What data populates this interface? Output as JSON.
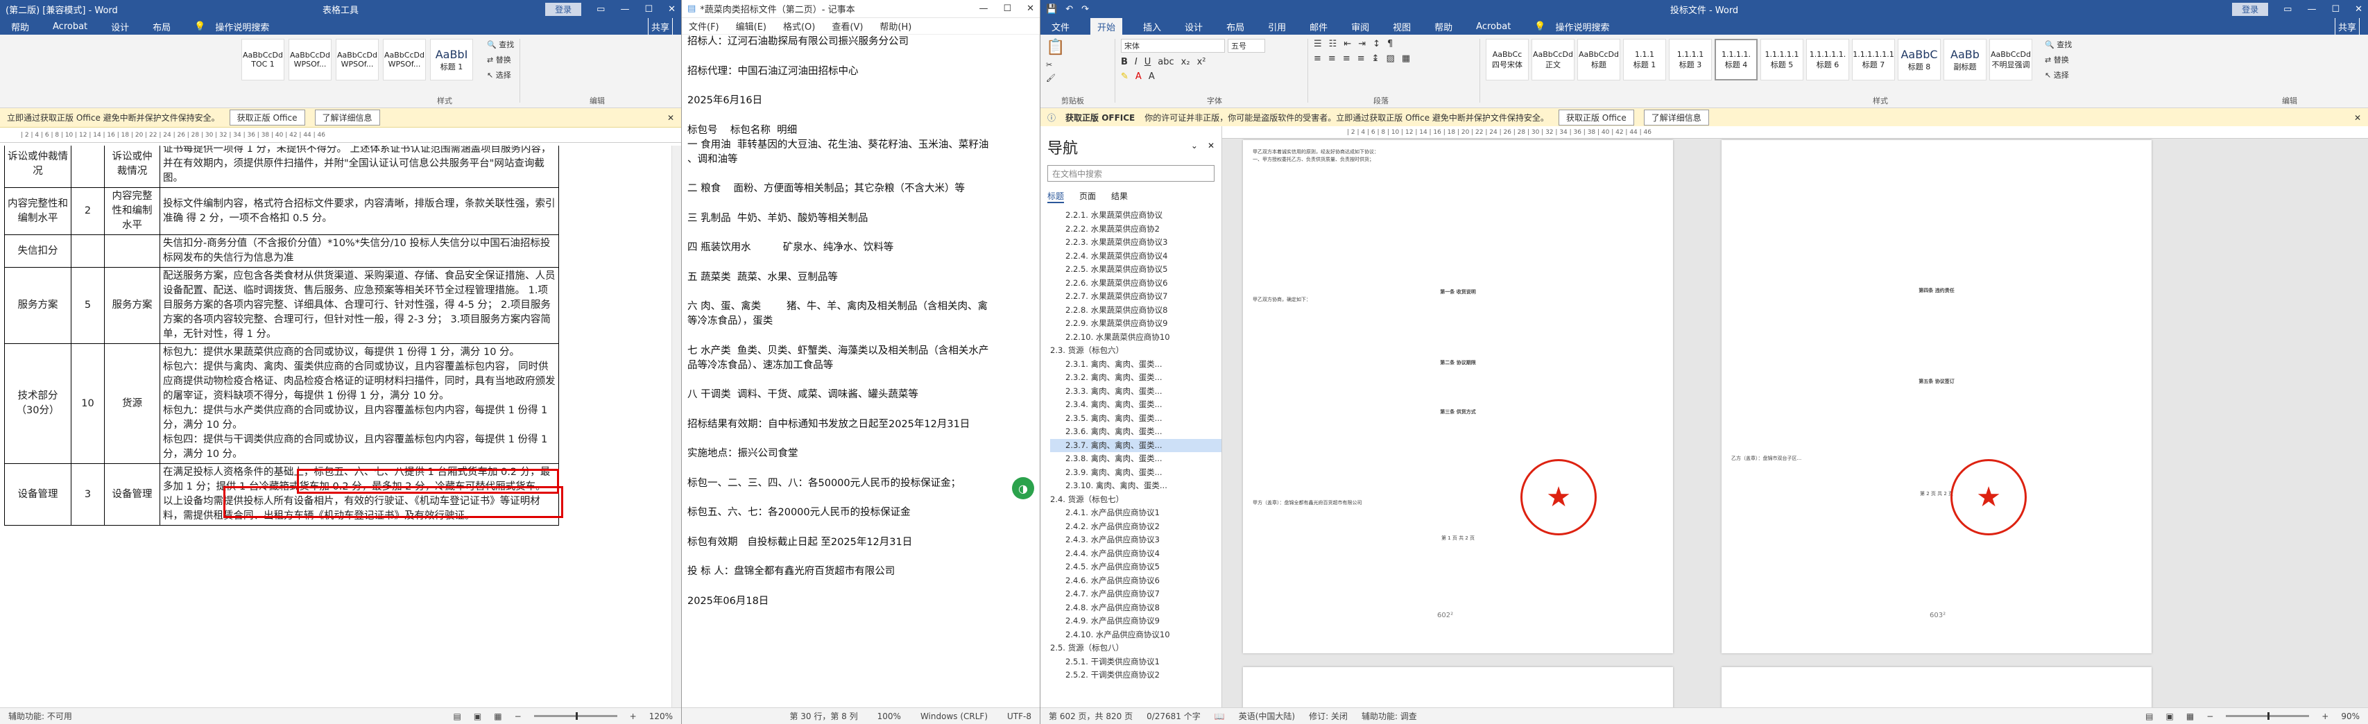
{
  "win1": {
    "title": "(第二版) [兼容模式] - Word",
    "table_tools": "表格工具",
    "login": "登录",
    "tabs": [
      "帮助",
      "Acrobat",
      "设计",
      "布局"
    ],
    "tellme": "操作说明搜索",
    "share": "共享",
    "styles": [
      {
        "preview": "AaBbCcDd",
        "name": "TOC 1"
      },
      {
        "preview": "AaBbCcDd",
        "name": "WPSOf..."
      },
      {
        "preview": "AaBbCcDd",
        "name": "WPSOf..."
      },
      {
        "preview": "AaBbCcDd",
        "name": "WPSOf..."
      },
      {
        "preview": "AaBbI",
        "name": "标题 1"
      }
    ],
    "edit_group": {
      "find": "查找",
      "replace": "替换",
      "select": "选择",
      "label": "编辑"
    },
    "styles_label": "样式",
    "msg": {
      "text": "立即通过获取正版 Office 避免中断并保护文件保持安全。",
      "btn1": "获取正版 Office",
      "btn2": "了解详细信息"
    },
    "table": {
      "rows": [
        {
          "c1": "诉讼或仲裁情况",
          "c2": "",
          "c3": "诉讼或仲裁情况",
          "c4": "证书每提供一项得 1 分，未提供不得分。 上述体系证书认证范围需涵盖项目服务内容，并在有效期内，须提供原件扫描件，并附\"全国认证认可信息公共服务平台\"网站查询截图。"
        },
        {
          "c1": "内容完整性和编制水平",
          "c2": "2",
          "c3": "内容完整性和编制水平",
          "c4": "投标文件编制内容，格式符合招标文件要求，内容清晰，排版合理，条款关联性强，索引准确 得 2 分，一项不合格扣 0.5 分。"
        },
        {
          "c1": "失信扣分",
          "c2": "",
          "c3": "",
          "c4": "失信扣分-商务分值（不含报价分值）*10%*失信分/10 投标人失信分以中国石油招标投标网发布的失信行为信息为准"
        },
        {
          "c1": "服务方案",
          "c2": "5",
          "c3": "服务方案",
          "c4": "配送服务方案，应包含各类食材从供货渠道、采购渠道、存储、食品安全保证措施、人员设备配置、配送、临时调拨货、售后服务、应急预案等相关环节全过程管理措施。 1.项目服务方案的各项内容完整、详细具体、合理可行、针对性强，得 4-5 分； 2.项目服务方案的各项内容较完整、合理可行，但针对性一般，得 2-3 分； 3.项目服务方案内容简单，无针对性，得 1 分。"
        },
        {
          "c1": "技术部分（30分）",
          "c2": "10",
          "c3": "货源",
          "c4a": "标包九：提供水果蔬菜供应商的合同或协议，每提供 1 份得 1 分，满分 10 分。",
          "c4b": "标包六：提供与禽肉、禽肉、蛋类供应商的合同或协议，且内容覆盖标包内容， 同时供应商提供动物检疫合格证、肉品检疫合格证的证明材料扫描件，同时，具有当地政府颁发的屠宰证，资料缺项不得分，每提供 1 份得 1 分，满分 10 分。",
          "c4c": "标包九：提供与水产类供应商的合同或协议，且内容覆盖标包内内容，每提供 1 份得 1 分，满分 10 分。",
          "c4d": "标包四：提供与干调类供应商的合同或协议，且内容覆盖标包内内容，每提供 1 份得 1 分，满分 10 分。"
        },
        {
          "c1": "设备管理",
          "c2": "3",
          "c3": "设备管理",
          "c4": "在满足投标人资格条件的基础上，标包五、六、七、八提供 1 台厢式货车加 0.2 分，最多加 1 分；提供 1 台冷藏箱式货车加 0.2 分，最多加 2 分，冷藏车可替代厢式货车。 以上设备均需提供投标人所有设备相片，有效的行驶证、《机动车登记证书》等证明材料，需提供租赁合同、出租方车辆《机动车登记证书》及有效行驶证。"
        }
      ]
    },
    "status": {
      "accessibility": "辅助功能: 不可用",
      "zoom": "120%"
    }
  },
  "win2": {
    "title": "*蔬菜肉类招标文件（第二页）- 记事本",
    "menu": [
      "文件(F)",
      "编辑(E)",
      "格式(O)",
      "查看(V)",
      "帮助(H)"
    ],
    "lines": [
      "招标人：辽河石油勘探局有限公司振兴服务分公司",
      "招标代理：中国石油辽河油田招标中心",
      "2025年6月16日",
      "标包号    标包名称  明细\n一 食用油  菲转基因的大豆油、花生油、葵花籽油、玉米油、菜籽油\n、调和油等",
      "二 粮食    面粉、方便面等相关制品；其它杂粮（不含大米）等",
      "三 乳制品  牛奶、羊奶、酸奶等相关制品",
      "四 瓶装饮用水          矿泉水、纯净水、饮料等",
      "五 蔬菜类  蔬菜、水果、豆制品等",
      "六 肉、蛋、禽类        猪、牛、羊、禽肉及相关制品（含相关肉、禽\n等冷冻食品），蛋类",
      "七 水产类  鱼类、贝类、虾蟹类、海藻类以及相关制品（含相关水产\n品等冷冻食品）、速冻加工食品等",
      "八 干调类  调料、干货、咸菜、调味酱、罐头蔬菜等",
      "招标结果有效期：自中标通知书发放之日起至2025年12月31日",
      "实施地点：振兴公司食堂",
      "标包一、二、三、四、八：各50000元人民币的投标保证金；",
      "标包五、六、七：各20000元人民币的投标保证金",
      "标包有效期   自投标截止日起 至2025年12月31日",
      "投 标 人：盘锦全都有鑫光府百货超市有限公司",
      "2025年06月18日"
    ],
    "status": {
      "pos": "第 30 行，第 8 列",
      "zoom": "100%",
      "eol": "Windows (CRLF)",
      "enc": "UTF-8"
    }
  },
  "win3": {
    "title": "投标文件 - Word",
    "login": "登录",
    "tabs": [
      "文件",
      "开始",
      "插入",
      "设计",
      "布局",
      "引用",
      "邮件",
      "审阅",
      "视图",
      "帮助",
      "Acrobat"
    ],
    "tellme": "操作说明搜索",
    "share": "共享",
    "font_name": "宋体",
    "font_size": "五号",
    "styles": [
      {
        "preview": "AaBbCc",
        "name": "四号宋体"
      },
      {
        "preview": "AaBbCcDd",
        "name": "正文"
      },
      {
        "preview": "AaBbCcDd",
        "name": "标题"
      },
      {
        "preview": "1.1.1",
        "name": "标题 1"
      },
      {
        "preview": "1.1.1.1",
        "name": "标题 3"
      },
      {
        "preview": "1.1.1.1.",
        "name": "标题 4"
      },
      {
        "preview": "1.1.1.1.1",
        "name": "标题 5"
      },
      {
        "preview": "1.1.1.1.1.",
        "name": "标题 6"
      },
      {
        "preview": "1.1.1.1.1.1",
        "name": "标题 7"
      },
      {
        "preview": "AaBbC",
        "name": "标题 8"
      },
      {
        "preview": "AaBb",
        "name": "副标题"
      },
      {
        "preview": "AaBbCcDd",
        "name": "不明显强调"
      }
    ],
    "groups": {
      "clipboard": "剪贴板",
      "font": "字体",
      "paragraph": "段落",
      "styles": "样式",
      "edit": "编辑"
    },
    "edit_group": {
      "find": "查找",
      "replace": "替换",
      "select": "选择"
    },
    "msg": {
      "title": "获取正版 OFFICE",
      "text": "你的许可证并非正版，你可能是盗版软件的受害者。立即通过获取正版 Office 避免中断并保护文件保持安全。",
      "btn1": "获取正版 Office",
      "btn2": "了解详细信息"
    },
    "nav": {
      "title": "导航",
      "search": "在文档中搜索",
      "tabs": [
        "标题",
        "页面",
        "结果"
      ],
      "items": [
        "2.2.1. 水果蔬菜供应商协议",
        "2.2.2. 水果蔬菜供应商协2",
        "2.2.3. 水果蔬菜供应商协议3",
        "2.2.4. 水果蔬菜供应商协议4",
        "2.2.5. 水果蔬菜供应商协议5",
        "2.2.6. 水果蔬菜供应商协议6",
        "2.2.7. 水果蔬菜供应商协议7",
        "2.2.8. 水果蔬菜供应商协议8",
        "2.2.9. 水果蔬菜供应商协议9",
        "2.2.10. 水果蔬菜供应商协10",
        "2.3. 货源（标包六）",
        "2.3.1. 禽肉、禽肉、蛋类...",
        "2.3.2. 禽肉、禽肉、蛋类...",
        "2.3.3. 禽肉、禽肉、蛋类...",
        "2.3.4. 禽肉、禽肉、蛋类...",
        "2.3.5. 禽肉、禽肉、蛋类...",
        "2.3.6. 禽肉、禽肉、蛋类...",
        "2.3.7. 禽肉、禽肉、蛋类...",
        "2.3.8. 禽肉、禽肉、蛋类...",
        "2.3.9. 禽肉、禽肉、蛋类...",
        "2.3.10. 禽肉、禽肉、蛋类...",
        "2.4. 货源（标包七）",
        "2.4.1. 水产品供应商协议1",
        "2.4.2. 水产品供应商协议2",
        "2.4.3. 水产品供应商协议3",
        "2.4.4. 水产品供应商协议4",
        "2.4.5. 水产品供应商协议5",
        "2.4.6. 水产品供应商协议6",
        "2.4.7. 水产品供应商协议7",
        "2.4.8. 水产品供应商协议8",
        "2.4.9. 水产品供应商协议9",
        "2.4.10. 水产品供应商协议10",
        "2.5. 货源（标包八）",
        "2.5.1. 干调类供应商协议1",
        "2.5.2. 干调类供应商协议2"
      ]
    },
    "page1": {
      "lines": [
        "甲乙双方本着诚实信用的原则，经友好协商达成如下协议：",
        "一、甲方授权委托乙方、负责供货质量、负责按时供货；",
        "第一条  收货说明",
        "甲乙双方协商，确定如下：",
        "第二条  协议期限",
        "第三条  供货方式",
        "甲方（盖章）：盘锦全都有鑫光府百货超市有限公司",
        "第 1 页 共 2 页"
      ]
    },
    "page2": {
      "lines": [
        "第四条  违约责任",
        "第五条  协议签订",
        "乙方（盖章）：盘锦市双台子区...",
        "第 2 页 共 2 页"
      ]
    },
    "page_tag1": "602²",
    "page_tag2": "603²",
    "status": {
      "page": "第 602 页，共 820 页",
      "words": "0/27681 个字",
      "lang": "英语(中国大陆)",
      "track": "修订: 关闭",
      "accessibility": "辅助功能: 调查",
      "zoom": "90%"
    }
  }
}
